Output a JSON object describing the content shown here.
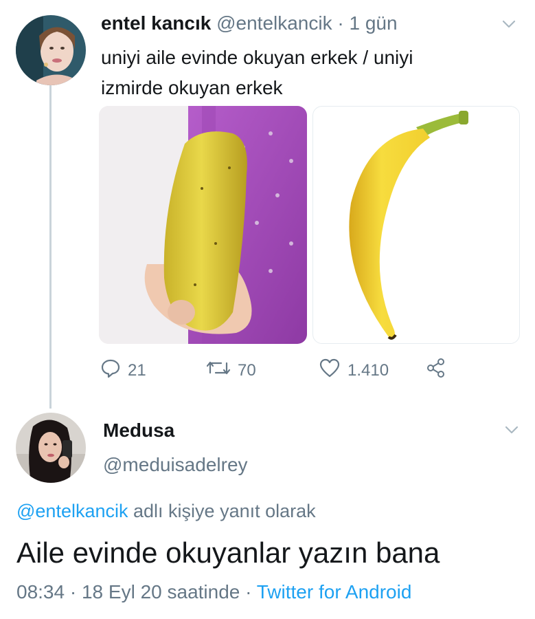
{
  "tweet": {
    "author_name": "entel kancık",
    "author_handle": "@entelkancik",
    "separator": "·",
    "time": "1 gün",
    "text_line1": "uniyi aile evinde okuyan erkek / uniyi",
    "text_line2": "izmirde okuyan erkek",
    "replies": "21",
    "retweets": "70",
    "likes": "1.410"
  },
  "reply": {
    "author_name": "Medusa",
    "author_handle": "@meduisadelrey",
    "replying_to_handle": "@entelkancik",
    "replying_to_suffix": "adlı kişiye yanıt olarak",
    "text": "Aile evinde okuyanlar yazın bana",
    "time": "08:34",
    "sep1": "·",
    "date": "18 Eyl 20 saatinde",
    "sep2": "·",
    "source": "Twitter for Android"
  },
  "colors": {
    "link": "#1da1f2",
    "muted": "#657786",
    "text": "#14171a",
    "thread_line": "#c9d3da",
    "banana": "#f2d43a",
    "sofa": "#a349b8"
  },
  "icons": [
    "chevron-down-icon",
    "reply-icon",
    "retweet-icon",
    "like-icon",
    "share-icon"
  ]
}
